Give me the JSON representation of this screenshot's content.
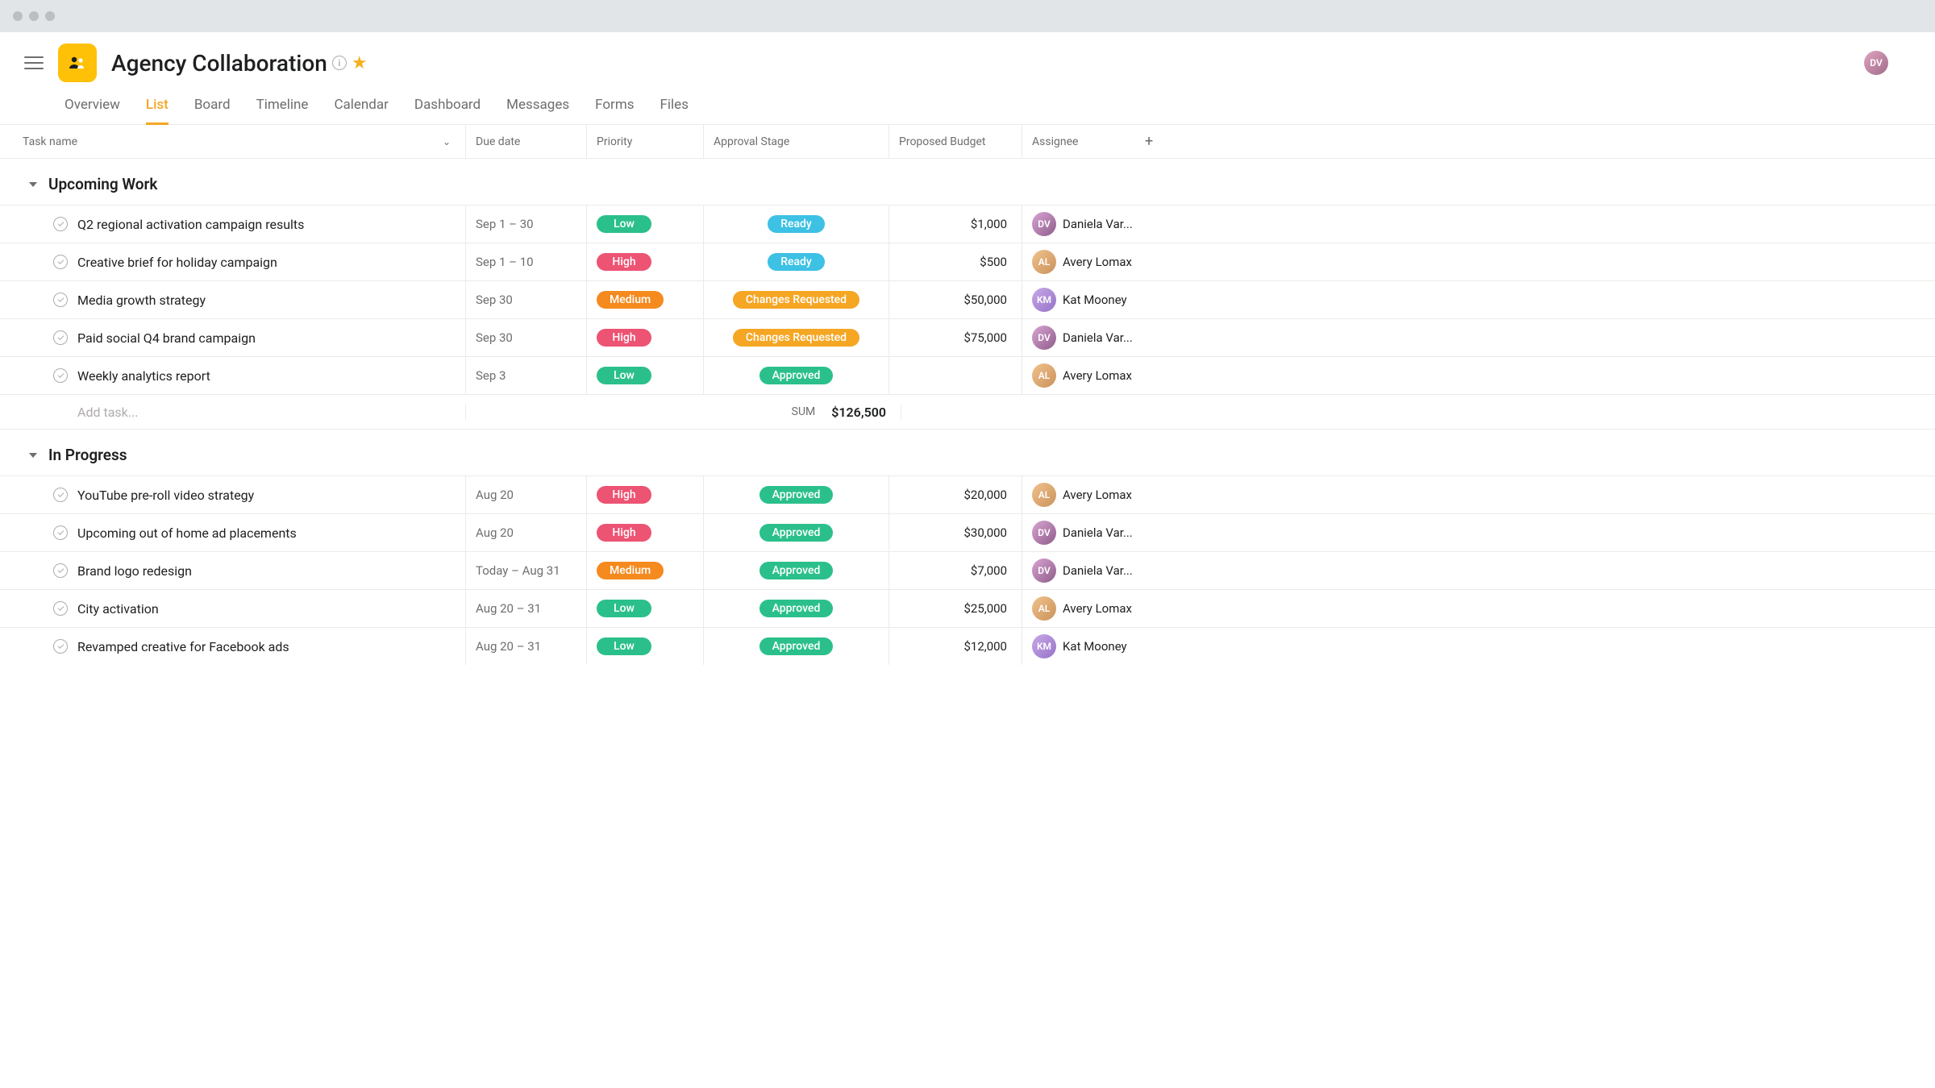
{
  "project": {
    "title": "Agency Collaboration",
    "icon_bg": "#fec107"
  },
  "tabs": [
    "Overview",
    "List",
    "Board",
    "Timeline",
    "Calendar",
    "Dashboard",
    "Messages",
    "Forms",
    "Files"
  ],
  "active_tab": "List",
  "columns": {
    "task": "Task name",
    "due": "Due date",
    "priority": "Priority",
    "stage": "Approval Stage",
    "budget": "Proposed Budget",
    "assignee": "Assignee"
  },
  "sections": [
    {
      "title": "Upcoming Work",
      "tasks": [
        {
          "name": "Q2 regional activation campaign results",
          "due": "Sep 1 – 30",
          "priority": "Low",
          "stage": "Ready",
          "budget": "$1,000",
          "assignee": "Daniela Var...",
          "avatar": "daniela"
        },
        {
          "name": "Creative brief for holiday campaign",
          "due": "Sep 1 – 10",
          "priority": "High",
          "stage": "Ready",
          "budget": "$500",
          "assignee": "Avery Lomax",
          "avatar": "avery"
        },
        {
          "name": "Media growth strategy",
          "due": "Sep 30",
          "priority": "Medium",
          "stage": "Changes Requested",
          "budget": "$50,000",
          "assignee": "Kat Mooney",
          "avatar": "kat"
        },
        {
          "name": "Paid social Q4 brand campaign",
          "due": "Sep 30",
          "priority": "High",
          "stage": "Changes Requested",
          "budget": "$75,000",
          "assignee": "Daniela Var...",
          "avatar": "daniela"
        },
        {
          "name": "Weekly analytics report",
          "due": "Sep 3",
          "priority": "Low",
          "stage": "Approved",
          "budget": "",
          "assignee": "Avery Lomax",
          "avatar": "avery"
        }
      ],
      "add_task_label": "Add task...",
      "sum_label": "SUM",
      "sum_value": "$126,500"
    },
    {
      "title": "In Progress",
      "tasks": [
        {
          "name": "YouTube pre-roll video strategy",
          "due": "Aug 20",
          "priority": "High",
          "stage": "Approved",
          "budget": "$20,000",
          "assignee": "Avery Lomax",
          "avatar": "avery"
        },
        {
          "name": "Upcoming out of home ad placements",
          "due": "Aug 20",
          "priority": "High",
          "stage": "Approved",
          "budget": "$30,000",
          "assignee": "Daniela Var...",
          "avatar": "daniela"
        },
        {
          "name": "Brand logo redesign",
          "due": "Today – Aug 31",
          "priority": "Medium",
          "stage": "Approved",
          "budget": "$7,000",
          "assignee": "Daniela Var...",
          "avatar": "daniela"
        },
        {
          "name": "City activation",
          "due": "Aug 20 – 31",
          "priority": "Low",
          "stage": "Approved",
          "budget": "$25,000",
          "assignee": "Avery Lomax",
          "avatar": "avery"
        },
        {
          "name": "Revamped creative for Facebook ads",
          "due": "Aug 20 – 31",
          "priority": "Low",
          "stage": "Approved",
          "budget": "$12,000",
          "assignee": "Kat Mooney",
          "avatar": "kat"
        }
      ]
    }
  ],
  "priority_colors": {
    "Low": "pill-low",
    "High": "pill-high",
    "Medium": "pill-medium"
  },
  "stage_colors": {
    "Ready": "pill-ready",
    "Changes Requested": "pill-changes",
    "Approved": "pill-approved"
  },
  "avatar_letters": {
    "daniela": "DV",
    "avery": "AL",
    "kat": "KM",
    "user": "DV"
  }
}
